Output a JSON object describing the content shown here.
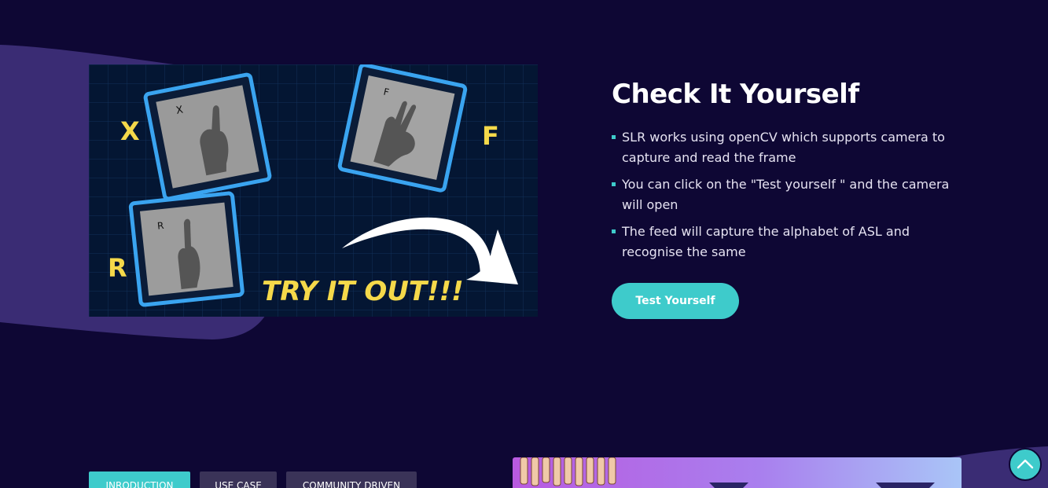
{
  "section": {
    "title": "Check It Yourself",
    "features": [
      "SLR works using openCV which supports camera to capture and read the frame",
      "You can click on the \"Test yourself \" and the camera will open",
      "The feed will capture the alphabet of ASL and recognise the same"
    ],
    "cta_label": "Test Yourself"
  },
  "showcase": {
    "letters": [
      "X",
      "F",
      "R"
    ],
    "card_captions": [
      "X",
      "F",
      "R"
    ],
    "tagline": "TRY IT OUT!!!"
  },
  "tabs": [
    "INRODUCTION",
    "USE CASE",
    "COMMUNITY DRIVEN"
  ],
  "colors": {
    "background": "#0e0734",
    "accent": "#3ecbcb",
    "blob": "#3a2c74",
    "tab_inactive": "#3a3358",
    "card_border": "#3aa4f0",
    "letter_yellow": "#f5d94a"
  },
  "icons": {
    "bullet": "square-bullet-icon",
    "scroll_top": "chevron-up-icon"
  }
}
